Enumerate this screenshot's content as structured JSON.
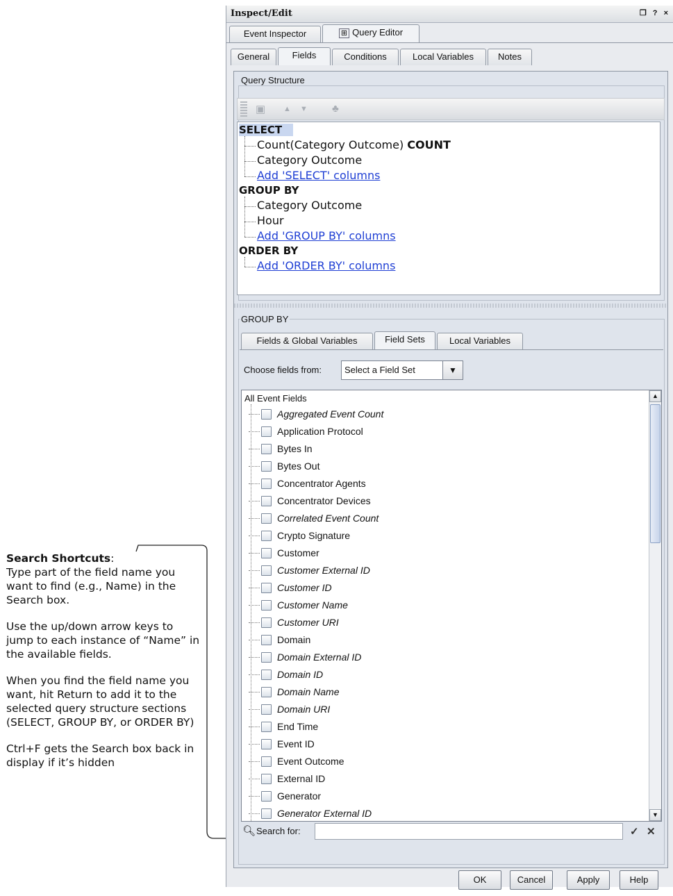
{
  "callout": {
    "title": "Search Shortcuts",
    "title_suffix": ":",
    "para1": "Type part of the field name you want to find (e.g., Name) in the Search box.",
    "para2": "Use the up/down arrow keys to jump to each instance of “Name” in the available fields.",
    "para3": "When you find the field name you want, hit Return to add it to the selected query structure sections (SELECT, GROUP BY, or ORDER BY)",
    "para4": "Ctrl+F gets the Search box back in display  if it’s hidden"
  },
  "window": {
    "title": "Inspect/Edit",
    "controls": "❐ ? ×"
  },
  "top_tabs": [
    "Event Inspector",
    "Query Editor"
  ],
  "sub_tabs": [
    "General",
    "Fields",
    "Conditions",
    "Local Variables",
    "Notes"
  ],
  "query_structure": {
    "label": "Query Structure",
    "select_kw": "SELECT",
    "select_items": [
      "Count(Category Outcome) ",
      "Category Outcome"
    ],
    "select_item0_suffix": "COUNT",
    "select_add": "Add 'SELECT' columns",
    "groupby_kw": "GROUP BY",
    "groupby_items": [
      "Category Outcome",
      "Hour"
    ],
    "groupby_add": "Add 'GROUP BY' columns",
    "orderby_kw": "ORDER BY",
    "orderby_add": "Add 'ORDER BY' columns"
  },
  "group_by": {
    "label": "GROUP BY",
    "tabs": [
      "Fields & Global Variables",
      "Field Sets",
      "Local Variables"
    ],
    "choose_label": "Choose fields from:",
    "select_value": "Select a Field Set",
    "root": "All Event Fields",
    "fields": [
      {
        "label": "Aggregated Event Count",
        "italic": true
      },
      {
        "label": "Application Protocol",
        "italic": false
      },
      {
        "label": "Bytes In",
        "italic": false
      },
      {
        "label": "Bytes Out",
        "italic": false
      },
      {
        "label": "Concentrator Agents",
        "italic": false
      },
      {
        "label": "Concentrator Devices",
        "italic": false
      },
      {
        "label": "Correlated Event Count",
        "italic": true
      },
      {
        "label": "Crypto Signature",
        "italic": false
      },
      {
        "label": "Customer",
        "italic": false
      },
      {
        "label": "Customer External ID",
        "italic": true
      },
      {
        "label": "Customer ID",
        "italic": true
      },
      {
        "label": "Customer Name",
        "italic": true
      },
      {
        "label": "Customer URI",
        "italic": true
      },
      {
        "label": "Domain",
        "italic": false
      },
      {
        "label": "Domain External ID",
        "italic": true
      },
      {
        "label": "Domain ID",
        "italic": true
      },
      {
        "label": "Domain Name",
        "italic": true
      },
      {
        "label": "Domain URI",
        "italic": true
      },
      {
        "label": "End Time",
        "italic": false
      },
      {
        "label": "Event ID",
        "italic": false
      },
      {
        "label": "Event Outcome",
        "italic": false
      },
      {
        "label": "External ID",
        "italic": false
      },
      {
        "label": "Generator",
        "italic": false
      },
      {
        "label": "Generator External ID",
        "italic": true
      }
    ],
    "search_label": "Search for:",
    "search_value": ""
  },
  "buttons": {
    "ok": "OK",
    "cancel": "Cancel",
    "apply": "Apply",
    "help": "Help"
  },
  "colors": {
    "link": "#1f3fd4",
    "panel_bg": "#dfe4ec"
  }
}
